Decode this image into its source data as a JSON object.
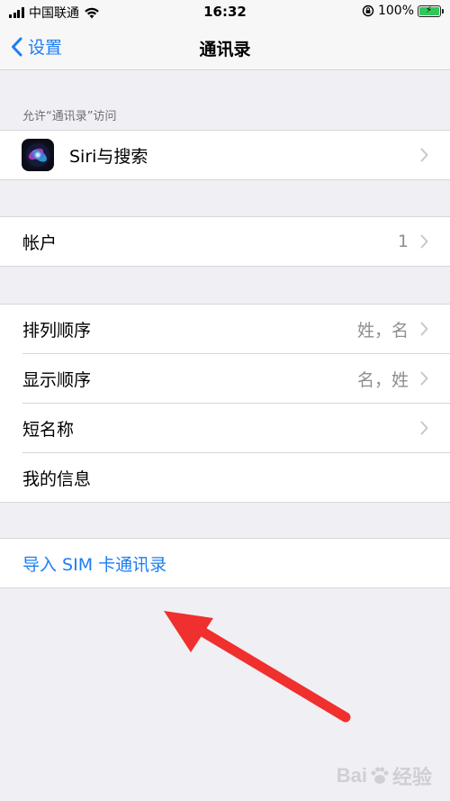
{
  "status_bar": {
    "carrier": "中国联通",
    "time": "16:32",
    "battery_percent": "100%"
  },
  "nav": {
    "back_label": "设置",
    "title": "通讯录"
  },
  "sections": {
    "allow_access_header": "允许“通讯录”访问",
    "siri_label": "Siri与搜索",
    "accounts_label": "帐户",
    "accounts_value": "1",
    "sort_order_label": "排列顺序",
    "sort_order_value": "姓，名",
    "display_order_label": "显示顺序",
    "display_order_value": "名，姓",
    "short_name_label": "短名称",
    "my_info_label": "我的信息",
    "import_sim_label": "导入 SIM 卡通讯录"
  },
  "watermark": {
    "text_left": "Bai",
    "text_right": "经验"
  },
  "colors": {
    "accent": "#1c7ef2",
    "background": "#efeff4",
    "arrow": "#f0302e"
  }
}
